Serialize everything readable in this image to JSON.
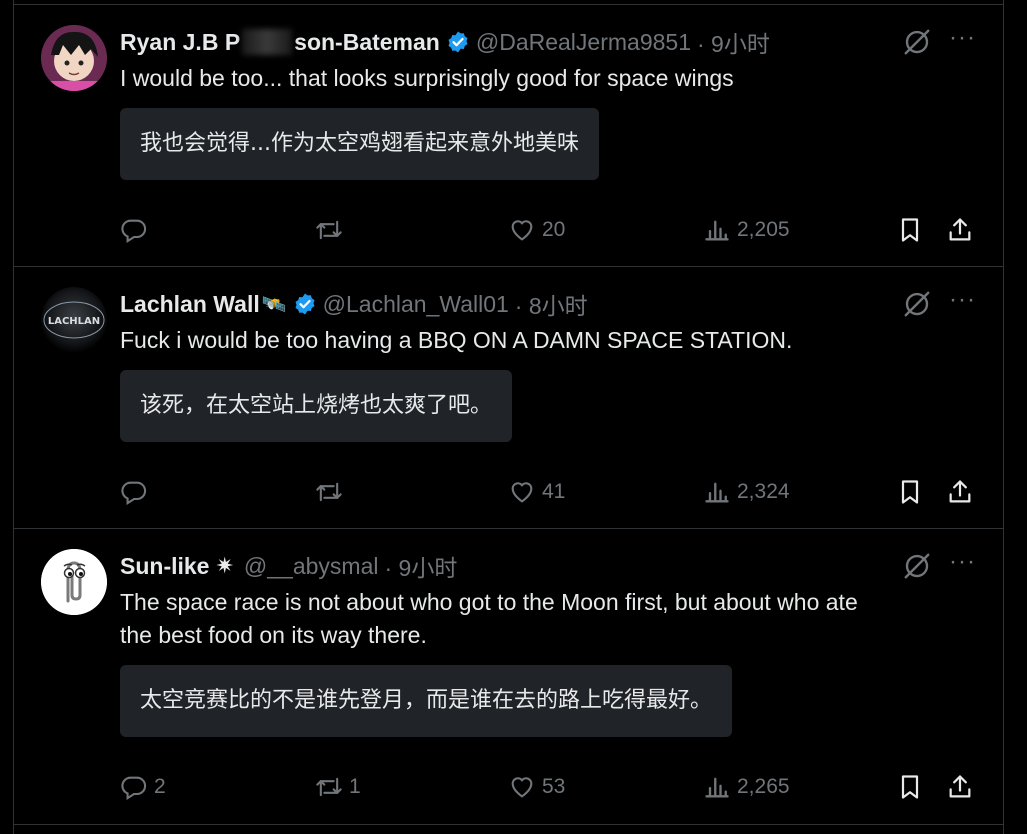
{
  "colors": {
    "background": "#000000",
    "text": "#e7e9ea",
    "muted": "#71767b",
    "verified": "#1d9bf0",
    "translation_bg": "#202327",
    "border": "#2f3336"
  },
  "tweets": [
    {
      "name": "Ryan J.B P",
      "name_rest": "son-Bateman",
      "handle": "@DaRealJerma9851",
      "time": "· 9小时",
      "verified": true,
      "text": "I would be too... that looks surprisingly good for space wings",
      "translation": "我也会觉得...作为太空鸡翅看起来意外地美味",
      "replies": "",
      "retweets": "",
      "likes": "20",
      "views": "2,205"
    },
    {
      "name": "Lachlan Wall",
      "name_emoji": "🛰️",
      "handle": "@Lachlan_Wall01",
      "time": "· 8小时",
      "verified": true,
      "avatar_text": "LACHLAN",
      "text": "Fuck i would be too having a BBQ ON A DAMN SPACE STATION.",
      "translation": "该死，在太空站上烧烤也太爽了吧。",
      "replies": "",
      "retweets": "",
      "likes": "41",
      "views": "2,324"
    },
    {
      "name": "Sun-like",
      "name_emoji": "✷",
      "handle": "@__abysmal",
      "time": "· 9小时",
      "verified": false,
      "text_line1": "The space race is not about who got to the Moon first, but about who ate",
      "text_line2": "the best food on its way there.",
      "translation": "太空竞赛比的不是谁先登月，而是谁在去的路上吃得最好。",
      "replies": "2",
      "retweets": "1",
      "likes": "53",
      "views": "2,265"
    }
  ],
  "icons": [
    "reply-icon",
    "retweet-icon",
    "like-icon",
    "views-icon",
    "bookmark-icon",
    "share-icon",
    "grok-icon",
    "more-icon",
    "verified-icon"
  ]
}
